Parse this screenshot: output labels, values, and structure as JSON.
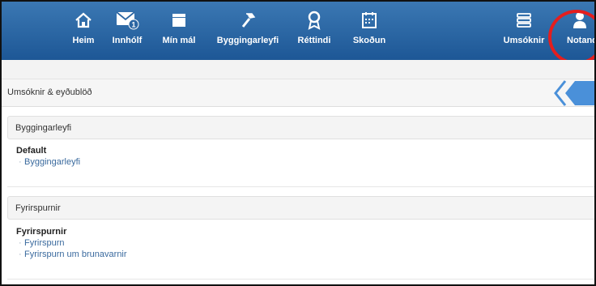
{
  "nav": {
    "items": [
      {
        "label": "Heim",
        "icon": "home-icon"
      },
      {
        "label": "Innhólf",
        "icon": "inbox-icon",
        "badge": "1"
      },
      {
        "label": "Mín mál",
        "icon": "folder-icon"
      },
      {
        "label": "Byggingarleyfi",
        "icon": "hammer-icon"
      },
      {
        "label": "Réttindi",
        "icon": "award-icon"
      },
      {
        "label": "Skoðun",
        "icon": "calendar-icon"
      },
      {
        "label": "Umsóknir",
        "icon": "list-icon"
      },
      {
        "label": "Notand",
        "icon": "user-icon"
      }
    ]
  },
  "page": {
    "title": "Umsóknir & eyðublöð"
  },
  "sections": [
    {
      "header": "Byggingarleyfi",
      "group": "Default",
      "links": [
        "Byggingarleyfi"
      ]
    },
    {
      "header": "Fyrirspurnir",
      "group": "Fyrirspurnir",
      "links": [
        "Fyrirspurn",
        "Fyrirspurn um brunavarnir"
      ]
    }
  ],
  "colors": {
    "nav_bg": "#1d5796",
    "link": "#3a6a9e",
    "highlight": "#e41e1e"
  }
}
